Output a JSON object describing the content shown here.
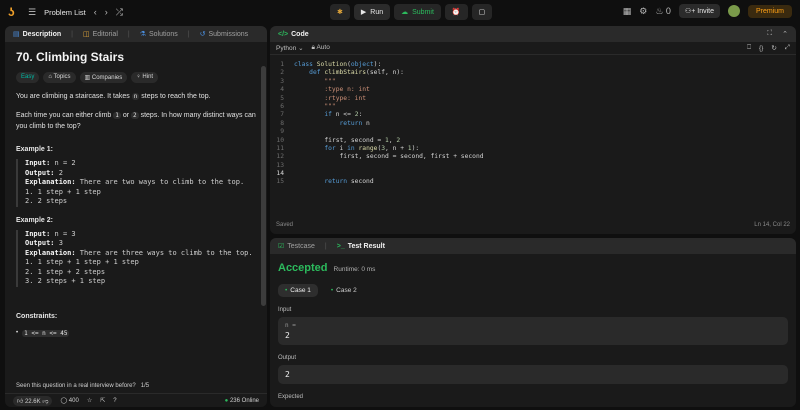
{
  "topbar": {
    "problem_list": "Problem List",
    "run": "Run",
    "submit": "Submit",
    "fire_count": "0",
    "invite": "Invite",
    "premium": "Premium"
  },
  "left": {
    "tabs": [
      "Description",
      "Editorial",
      "Solutions",
      "Submissions"
    ],
    "title": "70. Climbing Stairs",
    "tags": [
      "Easy",
      "Topics",
      "Companies",
      "Hint"
    ],
    "para1_a": "You are climbing a staircase. It takes ",
    "para1_code": "n",
    "para1_b": " steps to reach the top.",
    "para2_a": "Each time you can either climb ",
    "para2_c1": "1",
    "para2_mid": " or ",
    "para2_c2": "2",
    "para2_b": " steps. In how many distinct ways can you climb to the top?",
    "ex1_title": "Example 1:",
    "ex1": {
      "input_label": "Input:",
      "input_val": " n = 2",
      "output_label": "Output:",
      "output_val": " 2",
      "expl_label": "Explanation:",
      "expl_val": " There are two ways to climb to the top.",
      "l1": "1. 1 step + 1 step",
      "l2": "2. 2 steps"
    },
    "ex2_title": "Example 2:",
    "ex2": {
      "input_label": "Input:",
      "input_val": " n = 3",
      "output_label": "Output:",
      "output_val": " 3",
      "expl_label": "Explanation:",
      "expl_val": " There are three ways to climb to the top.",
      "l1": "1. 1 step + 1 step + 1 step",
      "l2": "2. 1 step + 2 steps",
      "l3": "3. 2 steps + 1 step"
    },
    "constraints_title": "Constraints:",
    "constraint": "1 <= n <= 45",
    "seen": "Seen this question in a real interview before?",
    "seen_count": "1/5",
    "likes": "22.6K",
    "comments": "400",
    "online": "236 Online"
  },
  "code": {
    "title": "Code",
    "lang": "Python",
    "auto": "Auto",
    "saved": "Saved",
    "pos": "Ln 14, Col 22",
    "lines": [
      "class Solution(object):",
      "    def climbStairs(self, n):",
      "        \"\"\"",
      "        :type n: int",
      "        :rtype: int",
      "        \"\"\"",
      "        if n <= 2:",
      "            return n",
      "",
      "        first, second = 1, 2",
      "        for i in range(3, n + 1):",
      "            first, second = second, first + second",
      "",
      "",
      "        return second"
    ]
  },
  "result": {
    "tab_testcase": "Testcase",
    "tab_result": "Test Result",
    "status": "Accepted",
    "runtime": "Runtime: 0 ms",
    "case1": "Case 1",
    "case2": "Case 2",
    "input_label": "Input",
    "input_key": "n =",
    "input_val": "2",
    "output_label": "Output",
    "output_val": "2",
    "expected_label": "Expected"
  }
}
